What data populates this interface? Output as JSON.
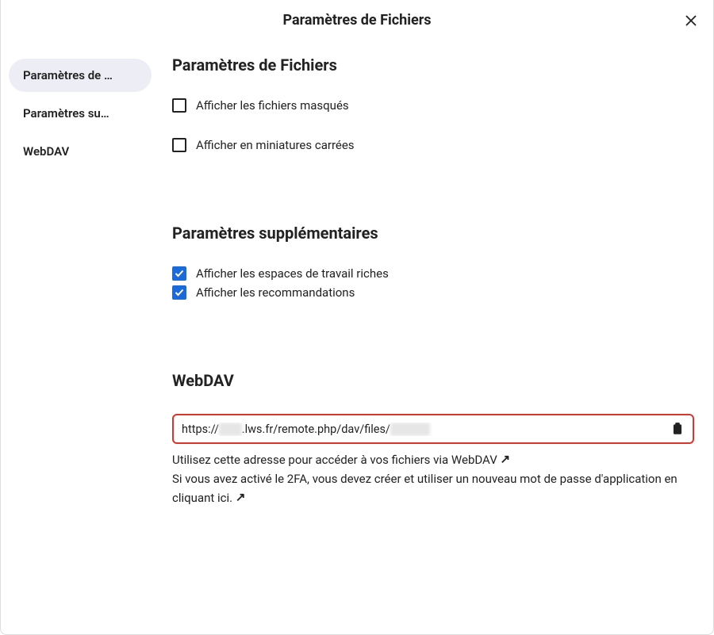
{
  "header": {
    "title": "Paramètres de Fichiers"
  },
  "sidebar": {
    "items": [
      {
        "label": "Paramètres de …",
        "active": true
      },
      {
        "label": "Paramètres su…",
        "active": false
      },
      {
        "label": "WebDAV",
        "active": false
      }
    ]
  },
  "sections": {
    "files": {
      "title": "Paramètres de Fichiers",
      "opts": [
        {
          "label": "Afficher les fichiers masqués",
          "checked": false
        },
        {
          "label": "Afficher en miniatures carrées",
          "checked": false
        }
      ]
    },
    "extra": {
      "title": "Paramètres supplémentaires",
      "opts": [
        {
          "label": "Afficher les espaces de travail riches",
          "checked": true
        },
        {
          "label": "Afficher les recommandations",
          "checked": true
        }
      ]
    },
    "webdav": {
      "title": "WebDAV",
      "url_prefix": "https://",
      "url_mid": ".lws.fr/remote.php/dav/files/",
      "help1": "Utilisez cette adresse pour accéder à vos fichiers via WebDAV",
      "help2a": "Si vous avez activé le 2FA, vous devez créer et utiliser un nouveau mot de passe d'application en cliquant ici."
    }
  }
}
